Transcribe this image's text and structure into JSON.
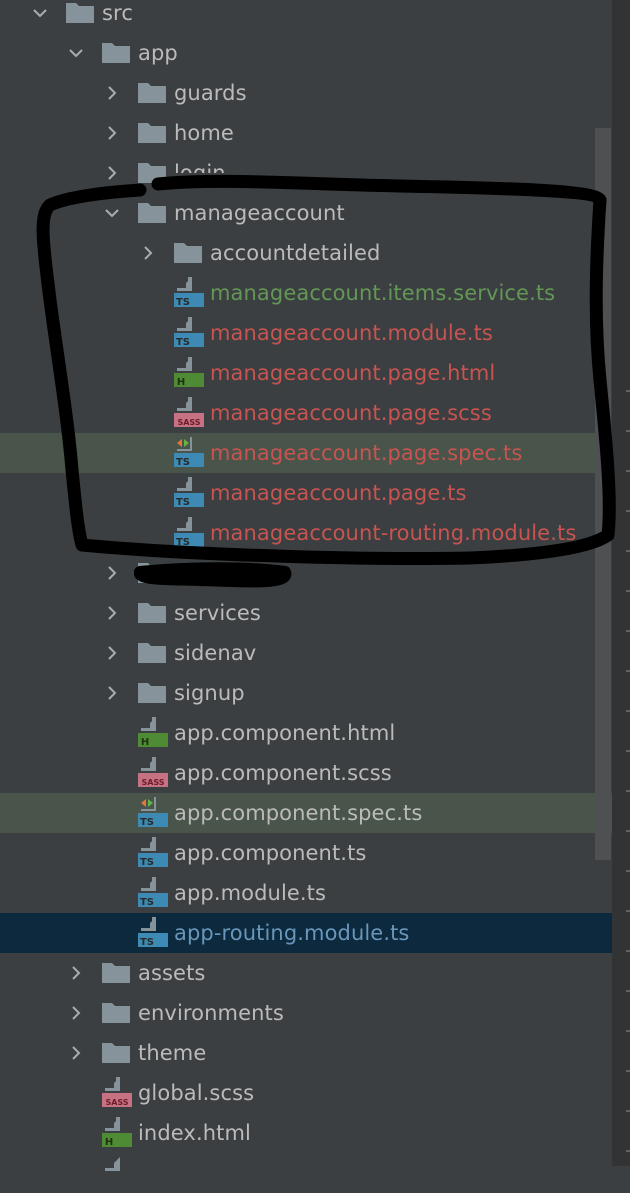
{
  "panel": "project-tree",
  "colors": {
    "background": "#3c3f41",
    "default_text": "#bbbbbb",
    "added_text": "#629755",
    "modified_text": "#c75450",
    "selected_text": "#6897bb",
    "selected_row": "#0d293e",
    "highlight_row": "#49544a",
    "ts_badge": "#3d8ab5",
    "html_badge": "#4f8a34",
    "sass_badge": "#c77283"
  },
  "tree": [
    {
      "label": "src",
      "type": "folder",
      "depth": 0,
      "expanded": true
    },
    {
      "label": "app",
      "type": "folder",
      "depth": 1,
      "expanded": true
    },
    {
      "label": "guards",
      "type": "folder",
      "depth": 2,
      "expanded": false
    },
    {
      "label": "home",
      "type": "folder",
      "depth": 2,
      "expanded": false
    },
    {
      "label": "login",
      "type": "folder",
      "depth": 2,
      "expanded": false
    },
    {
      "label": "manageaccount",
      "type": "folder",
      "depth": 2,
      "expanded": true
    },
    {
      "label": "accountdetailed",
      "type": "folder",
      "depth": 3,
      "expanded": false
    },
    {
      "label": "manageaccount.items.service.ts",
      "type": "ts",
      "depth": 3,
      "status": "added"
    },
    {
      "label": "manageaccount.module.ts",
      "type": "ts",
      "depth": 3,
      "status": "modified"
    },
    {
      "label": "manageaccount.page.html",
      "type": "html",
      "depth": 3,
      "status": "modified"
    },
    {
      "label": "manageaccount.page.scss",
      "type": "sass",
      "depth": 3,
      "status": "modified"
    },
    {
      "label": "manageaccount.page.spec.ts",
      "type": "spec",
      "depth": 3,
      "status": "modified",
      "highlighted": true
    },
    {
      "label": "manageaccount.page.ts",
      "type": "ts",
      "depth": 3,
      "status": "modified"
    },
    {
      "label": "manageaccount-routing.module.ts",
      "type": "ts",
      "depth": 3,
      "status": "modified"
    },
    {
      "label": "",
      "type": "folder",
      "depth": 2,
      "expanded": false,
      "redacted": true
    },
    {
      "label": "services",
      "type": "folder",
      "depth": 2,
      "expanded": false
    },
    {
      "label": "sidenav",
      "type": "folder",
      "depth": 2,
      "expanded": false
    },
    {
      "label": "signup",
      "type": "folder",
      "depth": 2,
      "expanded": false
    },
    {
      "label": "app.component.html",
      "type": "html",
      "depth": 2
    },
    {
      "label": "app.component.scss",
      "type": "sass",
      "depth": 2
    },
    {
      "label": "app.component.spec.ts",
      "type": "spec",
      "depth": 2,
      "highlighted": true
    },
    {
      "label": "app.component.ts",
      "type": "ts",
      "depth": 2
    },
    {
      "label": "app.module.ts",
      "type": "ts",
      "depth": 2
    },
    {
      "label": "app-routing.module.ts",
      "type": "ts",
      "depth": 2,
      "selected": true
    },
    {
      "label": "assets",
      "type": "folder",
      "depth": 1,
      "expanded": false
    },
    {
      "label": "environments",
      "type": "folder",
      "depth": 1,
      "expanded": false
    },
    {
      "label": "theme",
      "type": "folder",
      "depth": 1,
      "expanded": false
    },
    {
      "label": "global.scss",
      "type": "sass",
      "depth": 1
    },
    {
      "label": "index.html",
      "type": "html",
      "depth": 1
    },
    {
      "label": "",
      "type": "file",
      "depth": 1,
      "partial": true
    }
  ],
  "annotation": "hand-drawn outline around manageaccount folder"
}
